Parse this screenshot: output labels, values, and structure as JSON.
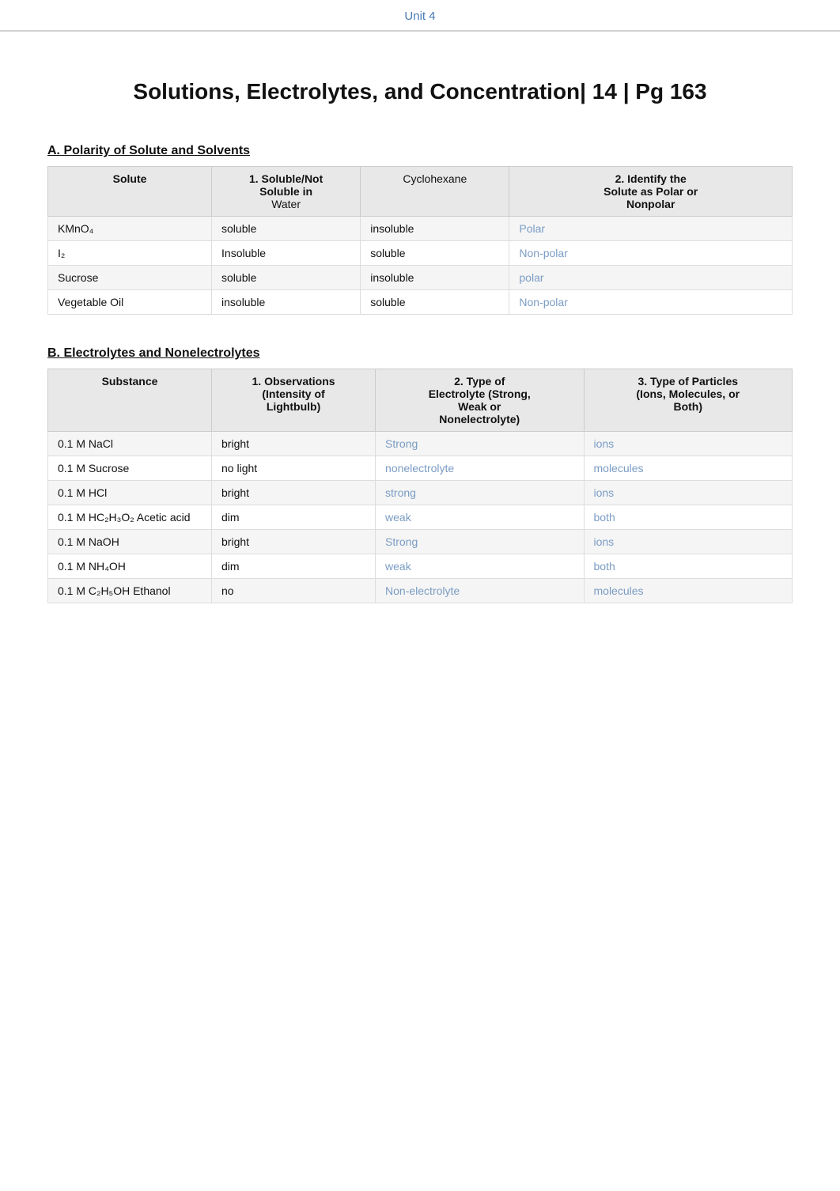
{
  "topbar": {
    "unit_label": "Unit 4"
  },
  "page_title": "Solutions, Electrolytes, and Concentration| 14 | Pg 163",
  "section_a": {
    "heading": "A.  Polarity of Solute and Solvents",
    "columns": [
      {
        "label": "Solute"
      },
      {
        "label": "1. Soluble/Not Soluble in"
      },
      {
        "label": ""
      },
      {
        "label": "2. Identify the Solute as Polar or Nonpolar"
      }
    ],
    "subheader": {
      "water": "Water",
      "cyclohexane": "Cyclohexane"
    },
    "rows": [
      {
        "solute": "KMnO₄",
        "water": "soluble",
        "cyclohexane": "insoluble",
        "polarity": "Polar",
        "colored": true
      },
      {
        "solute": "I₂",
        "water": "Insoluble",
        "cyclohexane": "soluble",
        "polarity": "Non-polar",
        "colored": true
      },
      {
        "solute": "Sucrose",
        "water": "soluble",
        "cyclohexane": "insoluble",
        "polarity": "polar",
        "colored": true
      },
      {
        "solute": "Vegetable Oil",
        "water": "insoluble",
        "cyclohexane": "soluble",
        "polarity": "Non-polar",
        "colored": true
      }
    ]
  },
  "section_b": {
    "heading": "B.  Electrolytes and Nonelectrolytes",
    "columns": [
      {
        "label": "Substance"
      },
      {
        "label": "1. Observations (Intensity of Lightbulb)"
      },
      {
        "label": "2. Type of Electrolyte (Strong, Weak or Nonelectrolyte)"
      },
      {
        "label": "3. Type of Particles (Ions, Molecules, or Both)"
      }
    ],
    "rows": [
      {
        "substance": "0.1 M NaCl",
        "observation": "bright",
        "electrolyte_type": "Strong",
        "particle_type": "ions",
        "et_colored": true,
        "pt_colored": true
      },
      {
        "substance": "0.1 M Sucrose",
        "observation": "no light",
        "electrolyte_type": "nonelectrolyte",
        "particle_type": "molecules",
        "et_colored": true,
        "pt_colored": true
      },
      {
        "substance": "0.1 M HCl",
        "observation": "bright",
        "electrolyte_type": "strong",
        "particle_type": "ions",
        "et_colored": true,
        "pt_colored": true
      },
      {
        "substance": "0.1 M HC₂H₃O₂ Acetic acid",
        "observation": "dim",
        "electrolyte_type": "weak",
        "particle_type": "both",
        "et_colored": true,
        "pt_colored": true
      },
      {
        "substance": "0.1 M NaOH",
        "observation": "bright",
        "electrolyte_type": "Strong",
        "particle_type": "ions",
        "et_colored": true,
        "pt_colored": true
      },
      {
        "substance": "0.1 M NH₄OH",
        "observation": "dim",
        "electrolyte_type": "weak",
        "particle_type": "both",
        "et_colored": true,
        "pt_colored": true
      },
      {
        "substance": "0.1 M C₂H₅OH Ethanol",
        "observation": "no",
        "electrolyte_type": "Non-electrolyte",
        "particle_type": "molecules",
        "et_colored": true,
        "pt_colored": true
      }
    ]
  }
}
